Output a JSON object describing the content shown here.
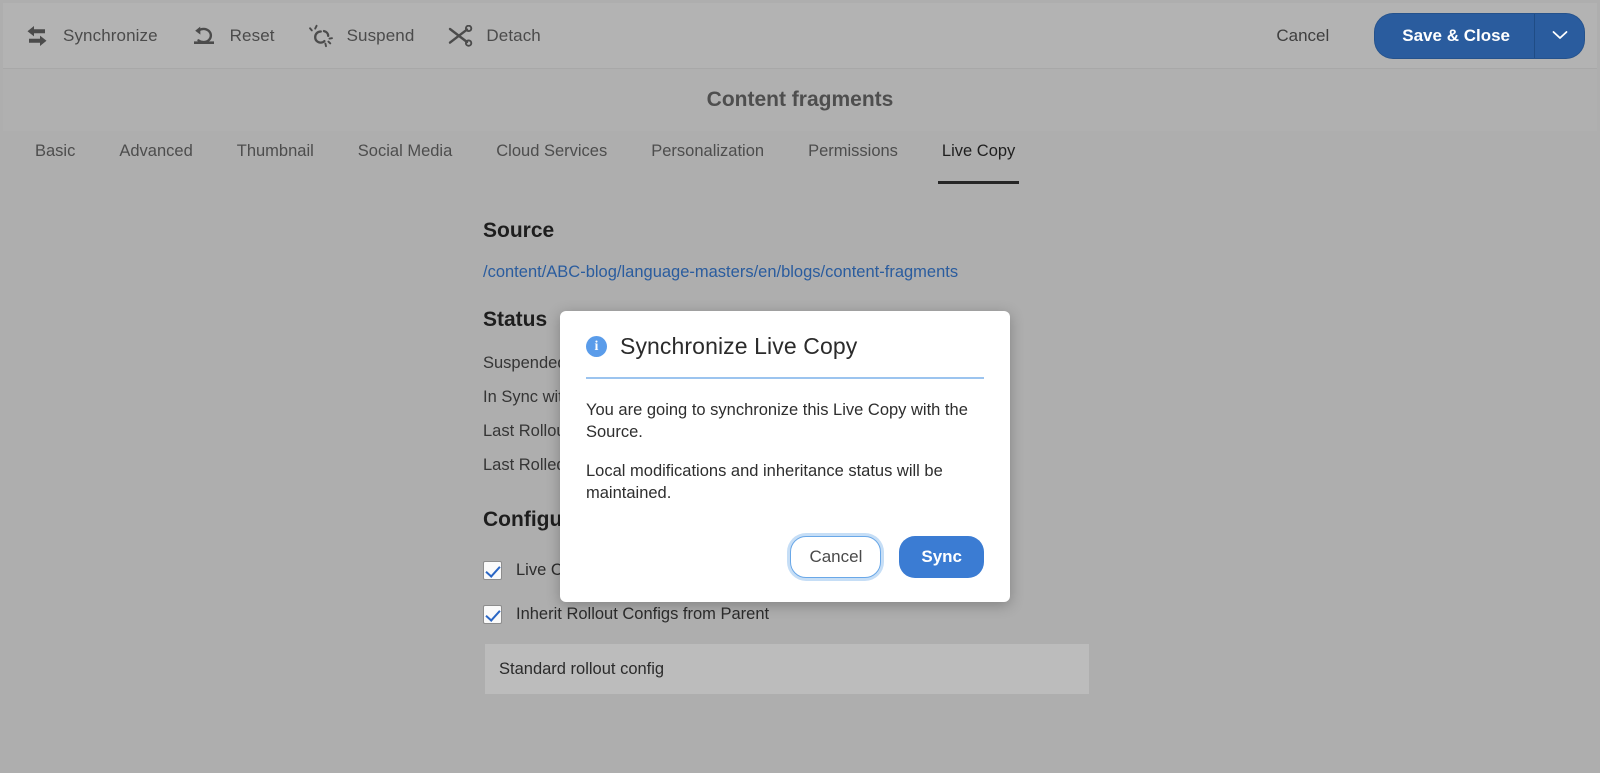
{
  "colors": {
    "page_bg": "#aeaeae",
    "toolbar_bg": "#b3b3b3",
    "accent_blue": "#2a5c9e",
    "link_blue": "#2a5c9e",
    "dialog_accent": "#3b7cd3",
    "info_icon": "#5a9cea",
    "checkbox_check": "#2a66c4",
    "rollout_box": "#bcbcbc"
  },
  "toolbar": {
    "actions": [
      {
        "label": "Synchronize",
        "icon": "synchronize-arrows-icon"
      },
      {
        "label": "Reset",
        "icon": "undo-reset-icon"
      },
      {
        "label": "Suspend",
        "icon": "broken-link-icon"
      },
      {
        "label": "Detach",
        "icon": "scissors-icon"
      }
    ],
    "cancel_label": "Cancel",
    "save_label": "Save & Close",
    "save_caret_icon": "chevron-down-icon"
  },
  "header": {
    "title": "Content fragments"
  },
  "tabs": [
    {
      "label": "Basic",
      "active": false
    },
    {
      "label": "Advanced",
      "active": false
    },
    {
      "label": "Thumbnail",
      "active": false
    },
    {
      "label": "Social Media",
      "active": false
    },
    {
      "label": "Cloud Services",
      "active": false
    },
    {
      "label": "Personalization",
      "active": false
    },
    {
      "label": "Permissions",
      "active": false
    },
    {
      "label": "Live Copy",
      "active": true
    }
  ],
  "main": {
    "source": {
      "heading": "Source",
      "path": "/content/ABC-blog/language-masters/en/blogs/content-fragments"
    },
    "status": {
      "heading": "Status",
      "rows": [
        "Suspended",
        "In Sync with",
        "Last Rollout",
        "Last Rolled"
      ]
    },
    "configuration": {
      "heading": "Configur",
      "checkboxes": [
        {
          "label": "Live Co",
          "checked": true
        },
        {
          "label": "Inherit Rollout Configs from Parent",
          "checked": true
        }
      ],
      "rollout_config": "Standard rollout config"
    }
  },
  "dialog": {
    "icon": "info-circle-icon",
    "title": "Synchronize Live Copy",
    "paragraphs": [
      "You are going to synchronize this Live Copy with the Source.",
      "Local modifications and inheritance status will be maintained."
    ],
    "cancel_label": "Cancel",
    "confirm_label": "Sync"
  }
}
